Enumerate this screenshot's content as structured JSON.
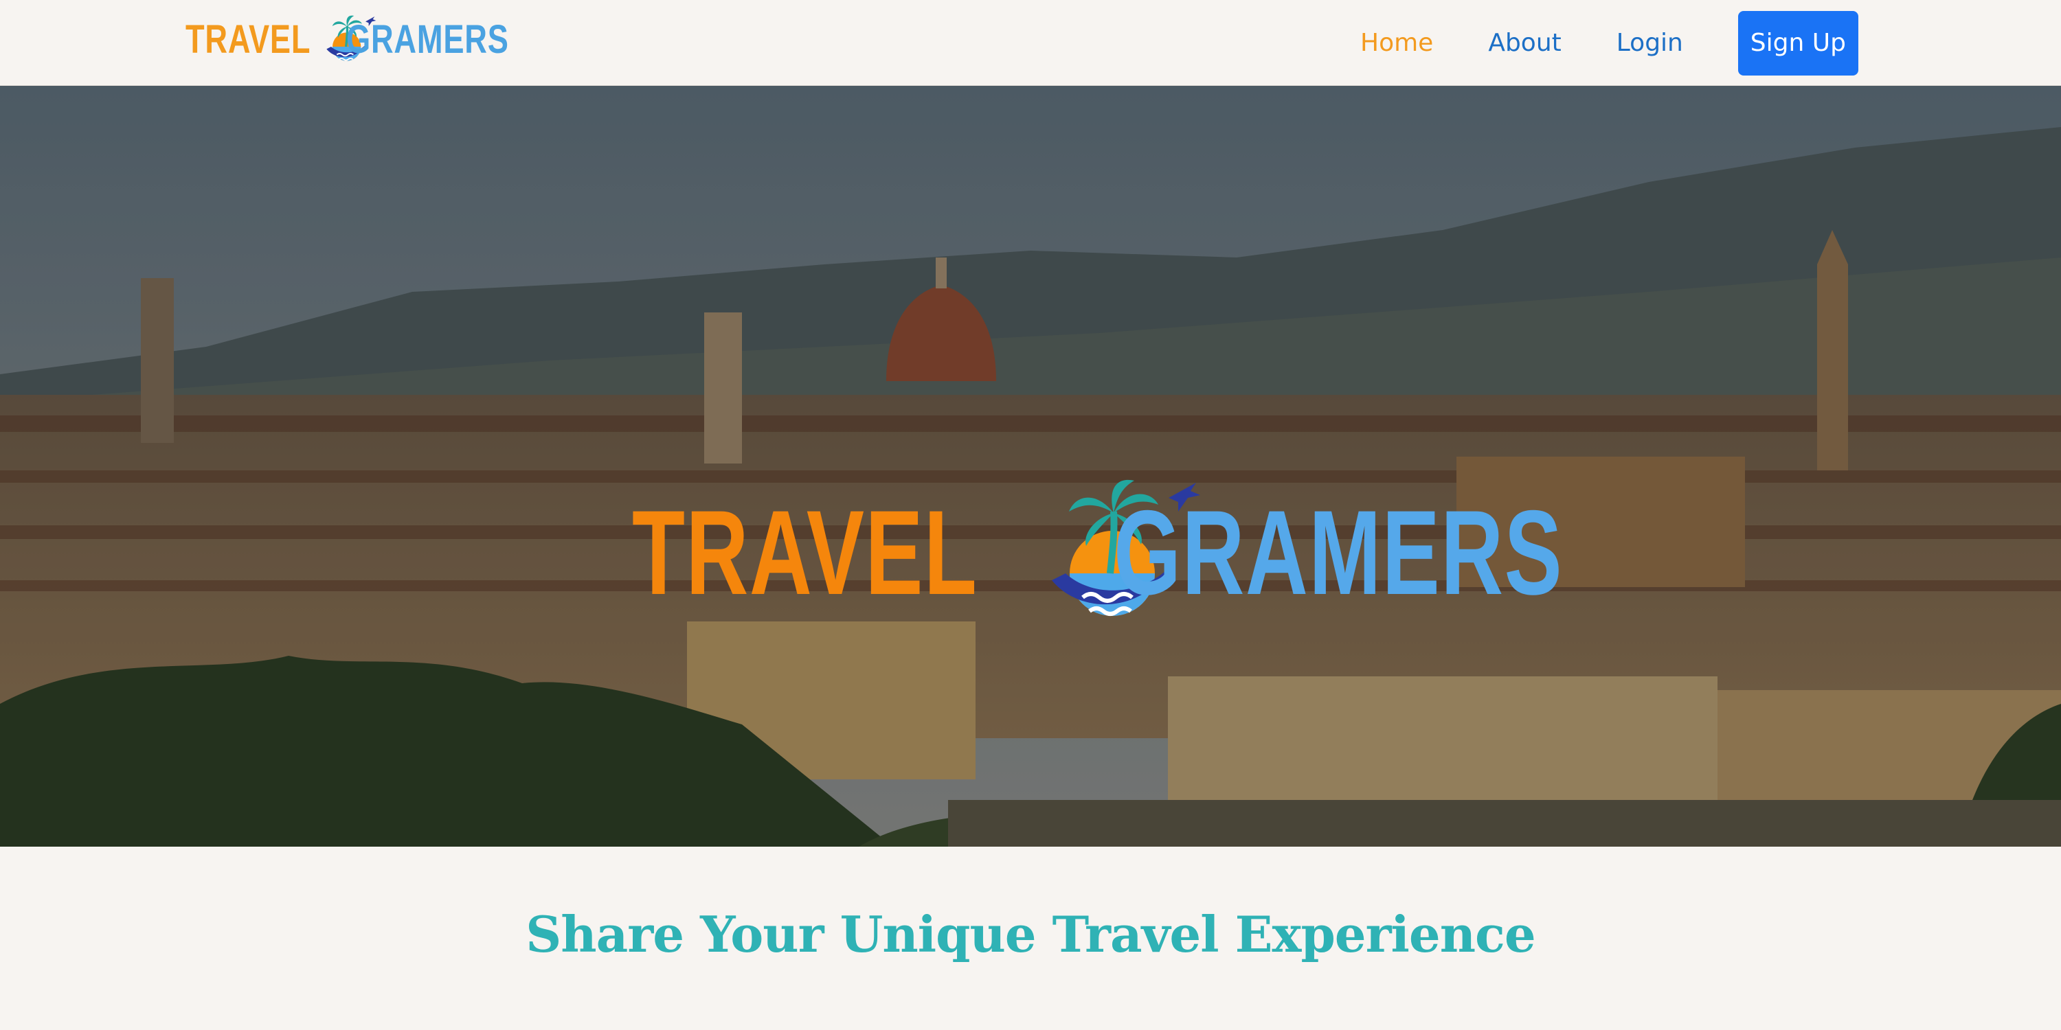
{
  "brand": {
    "word_left": "TRAVEL",
    "word_right": "GRAMERS",
    "globe_icon": "palm-globe-plane-icon",
    "colors": {
      "orange": "#f39a1e",
      "blue": "#4aa2e1",
      "navy": "#2a3aa0"
    }
  },
  "nav": {
    "items": [
      {
        "label": "Home",
        "active": true
      },
      {
        "label": "About",
        "active": false
      },
      {
        "label": "Login",
        "active": false
      }
    ],
    "signup_label": "Sign Up",
    "signup_color": "#1a73f5"
  },
  "hero": {
    "background": "florence-cityscape-photo",
    "logo_word_left": "TRAVEL",
    "logo_word_right": "GRAMERS"
  },
  "section": {
    "title": "Share Your Unique Travel Experience",
    "title_color": "#2fb2b5"
  }
}
